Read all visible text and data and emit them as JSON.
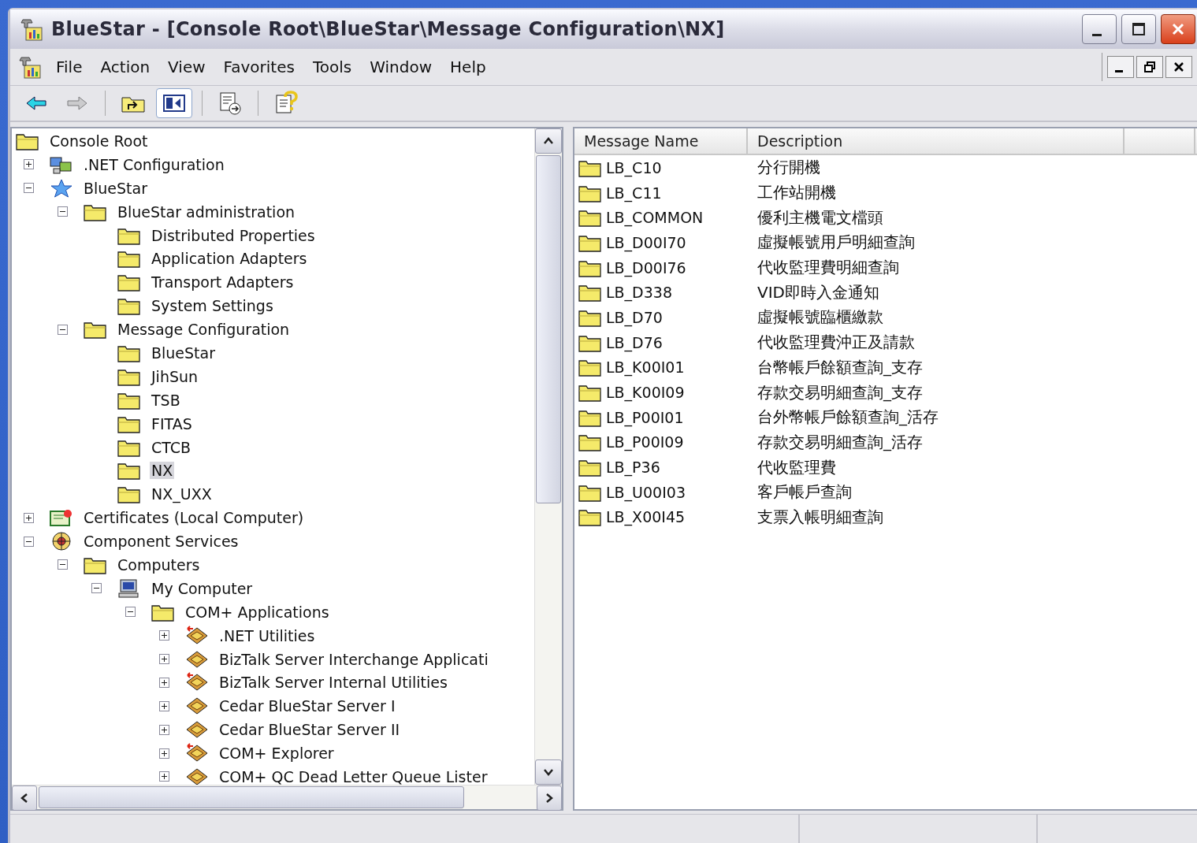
{
  "window": {
    "title": "BlueStar - [Console Root\\BlueStar\\Message Configuration\\NX]"
  },
  "menu": [
    "File",
    "Action",
    "View",
    "Favorites",
    "Tools",
    "Window",
    "Help"
  ],
  "toolbar": [
    {
      "kind": "back",
      "disabled": false,
      "selected": false
    },
    {
      "kind": "forward",
      "disabled": true,
      "selected": false
    },
    {
      "kind": "separator"
    },
    {
      "kind": "up",
      "disabled": false,
      "selected": false
    },
    {
      "kind": "tree",
      "disabled": false,
      "selected": true
    },
    {
      "kind": "separator"
    },
    {
      "kind": "export",
      "disabled": false,
      "selected": false
    },
    {
      "kind": "separator"
    },
    {
      "kind": "help",
      "disabled": false,
      "selected": false
    }
  ],
  "tree": [
    {
      "label": "Console Root",
      "kind": "folder",
      "selected": false,
      "children": [
        {
          "label": ".NET Configuration",
          "kind": "config",
          "expanded": false,
          "selected": false
        },
        {
          "label": "BlueStar",
          "kind": "star",
          "expanded": true,
          "selected": false,
          "children": [
            {
              "label": "BlueStar administration",
              "kind": "folder",
              "expanded": true,
              "selected": false,
              "children": [
                {
                  "label": "Distributed Properties",
                  "kind": "folder",
                  "selected": false
                },
                {
                  "label": "Application Adapters",
                  "kind": "folder",
                  "selected": false
                },
                {
                  "label": "Transport Adapters",
                  "kind": "folder",
                  "selected": false
                },
                {
                  "label": "System Settings",
                  "kind": "folder",
                  "selected": false
                }
              ]
            },
            {
              "label": "Message Configuration",
              "kind": "folder",
              "expanded": true,
              "selected": false,
              "children": [
                {
                  "label": "BlueStar",
                  "kind": "folder",
                  "selected": false
                },
                {
                  "label": "JihSun",
                  "kind": "folder",
                  "selected": false
                },
                {
                  "label": "TSB",
                  "kind": "folder",
                  "selected": false
                },
                {
                  "label": "FITAS",
                  "kind": "folder",
                  "selected": false
                },
                {
                  "label": "CTCB",
                  "kind": "folder",
                  "selected": false
                },
                {
                  "label": "NX",
                  "kind": "folder",
                  "selected": true
                },
                {
                  "label": "NX_UXX",
                  "kind": "folder",
                  "selected": false
                }
              ]
            }
          ]
        },
        {
          "label": "Certificates (Local Computer)",
          "kind": "cert",
          "expanded": false,
          "selected": false
        },
        {
          "label": "Component Services",
          "kind": "component",
          "expanded": true,
          "selected": false,
          "children": [
            {
              "label": "Computers",
              "kind": "folder",
              "expanded": true,
              "selected": false,
              "children": [
                {
                  "label": "My Computer",
                  "kind": "computer",
                  "expanded": true,
                  "selected": false,
                  "children": [
                    {
                      "label": "COM+ Applications",
                      "kind": "folder",
                      "expanded": true,
                      "selected": false,
                      "children": [
                        {
                          "label": ".NET Utilities",
                          "kind": "app-arrow",
                          "expanded": false,
                          "selected": false
                        },
                        {
                          "label": "BizTalk Server Interchange Applicati",
                          "kind": "app",
                          "expanded": false,
                          "selected": false
                        },
                        {
                          "label": "BizTalk Server Internal Utilities",
                          "kind": "app-arrow",
                          "expanded": false,
                          "selected": false
                        },
                        {
                          "label": "Cedar BlueStar Server I",
                          "kind": "app",
                          "expanded": false,
                          "selected": false
                        },
                        {
                          "label": "Cedar BlueStar Server II",
                          "kind": "app",
                          "expanded": false,
                          "selected": false
                        },
                        {
                          "label": "COM+ Explorer",
                          "kind": "app-arrow",
                          "expanded": false,
                          "selected": false
                        },
                        {
                          "label": "COM+ QC Dead Letter Queue Lister",
                          "kind": "app",
                          "expanded": false,
                          "selected": false
                        }
                      ]
                    }
                  ]
                }
              ]
            }
          ]
        }
      ]
    }
  ],
  "list": {
    "columns": [
      "Message Name",
      "Description"
    ],
    "rows": [
      {
        "name": "LB_C10",
        "description": "分行開機"
      },
      {
        "name": "LB_C11",
        "description": "工作站開機"
      },
      {
        "name": "LB_COMMON",
        "description": "優利主機電文檔頭"
      },
      {
        "name": "LB_D00I70",
        "description": "虛擬帳號用戶明細查詢"
      },
      {
        "name": "LB_D00I76",
        "description": "代收監理費明細查詢"
      },
      {
        "name": "LB_D338",
        "description": "VID即時入金通知"
      },
      {
        "name": "LB_D70",
        "description": "虛擬帳號臨櫃繳款"
      },
      {
        "name": "LB_D76",
        "description": "代收監理費沖正及請款"
      },
      {
        "name": "LB_K00I01",
        "description": "台幣帳戶餘額查詢_支存"
      },
      {
        "name": "LB_K00I09",
        "description": "存款交易明細查詢_支存"
      },
      {
        "name": "LB_P00I01",
        "description": "台外幣帳戶餘額查詢_活存"
      },
      {
        "name": "LB_P00I09",
        "description": "存款交易明細查詢_活存"
      },
      {
        "name": "LB_P36",
        "description": "代收監理費"
      },
      {
        "name": "LB_U00I03",
        "description": "客戶帳戶查詢"
      },
      {
        "name": "LB_X00I45",
        "description": "支票入帳明細查詢"
      }
    ]
  }
}
